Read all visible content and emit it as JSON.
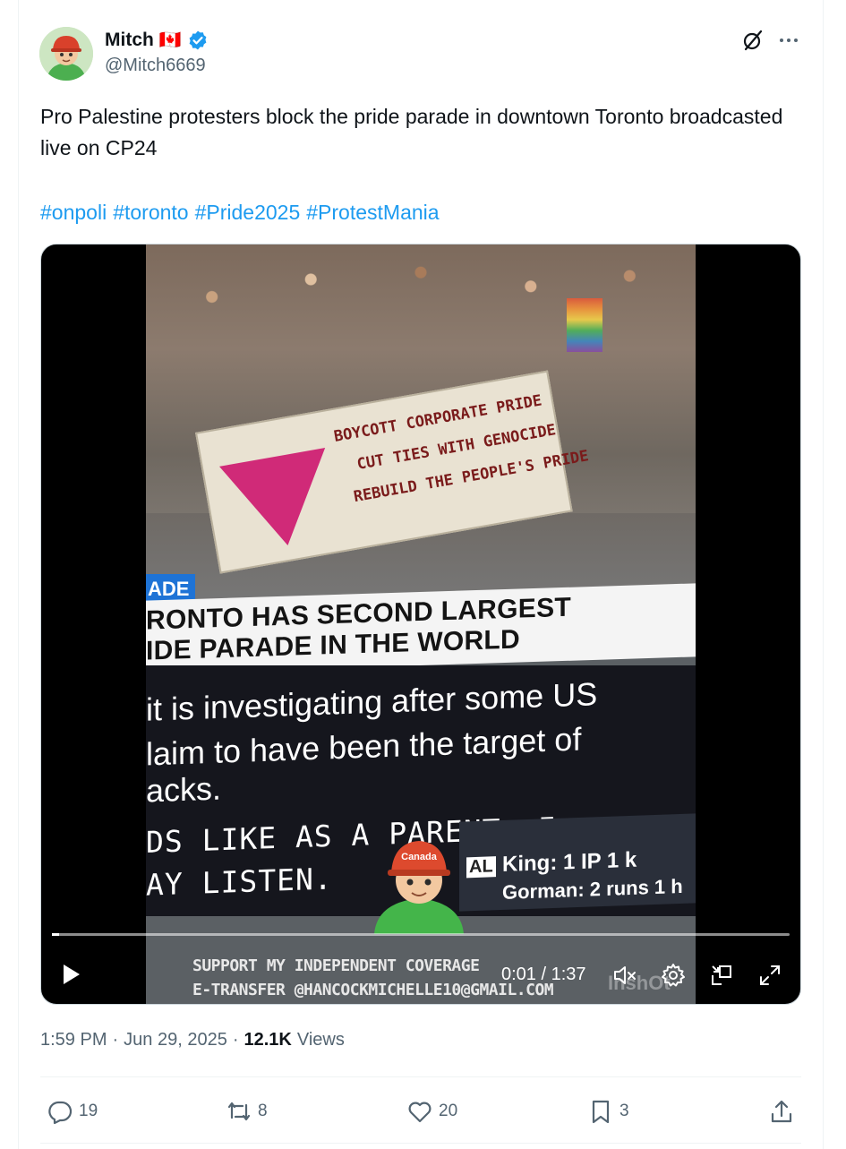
{
  "author": {
    "display_name": "Mitch",
    "flag": "🇨🇦",
    "handle": "@Mitch6669"
  },
  "tweet": {
    "text": "Pro Palestine protesters block the pride parade in downtown Toronto broadcasted live on CP24",
    "hashtags": [
      "#onpoli",
      "#toronto",
      "#Pride2025",
      "#ProtestMania"
    ]
  },
  "video": {
    "banner": [
      "BOYCOTT CORPORATE PRIDE",
      "CUT TIES WITH GENOCIDE",
      "REBUILD THE PEOPLE'S PRIDE"
    ],
    "label_box": "ADE",
    "headline": [
      "RONTO HAS SECOND LARGEST",
      "IDE PARADE IN THE WORLD"
    ],
    "ticker": [
      "it is investigating after some US",
      "laim to have been the target of",
      "acks."
    ],
    "captions": [
      "DS LIKE AS A PARENT, I",
      "AY LISTEN."
    ],
    "score_tag": "AL",
    "score_lines": [
      "King: 1 IP  1 k",
      "Gorman: 2 runs  1 h"
    ],
    "mascot_text": "Canada",
    "support": [
      "SUPPORT MY INDEPENDENT COVERAGE",
      "E-TRANSFER @HANCOCKMICHELLE10@GMAIL.COM"
    ],
    "watermark": "InshOt",
    "time_current": "0:01",
    "time_sep": "/",
    "time_total": "1:37",
    "progress": 0.01
  },
  "meta": {
    "time": "1:59 PM",
    "sep1": "·",
    "date": "Jun 29, 2025",
    "sep2": "·",
    "views_count": "12.1K",
    "views_label": "Views"
  },
  "actions": {
    "replies": "19",
    "reposts": "8",
    "likes": "20",
    "bookmarks": "3"
  },
  "colors": {
    "accent": "#1d9bf0",
    "muted": "#536471",
    "verified": "#1d9bf0"
  }
}
